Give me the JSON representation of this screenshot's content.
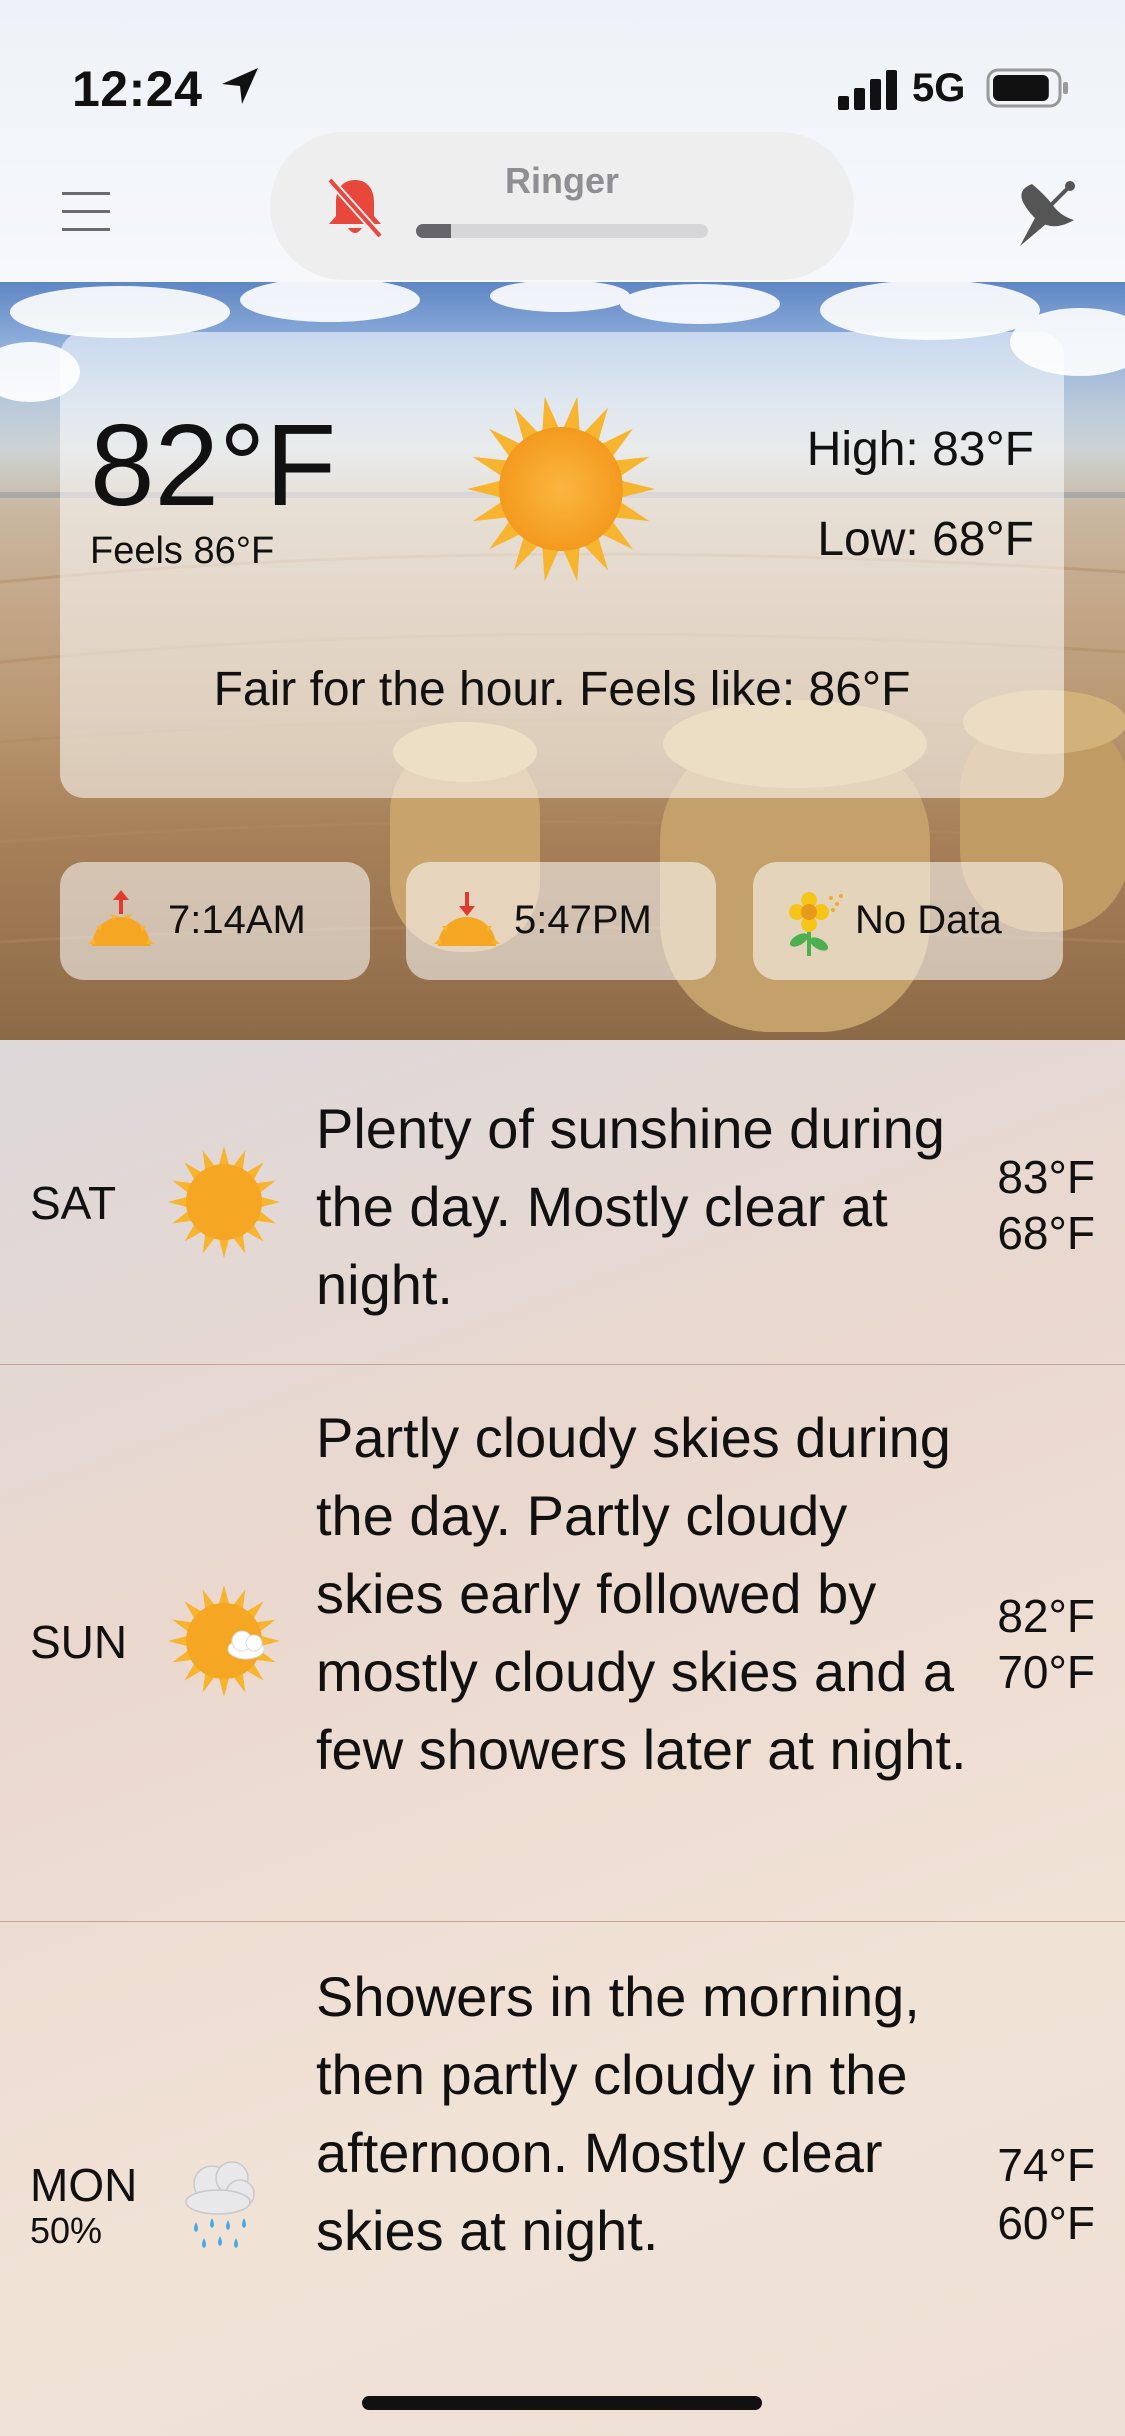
{
  "status_bar": {
    "time": "12:24",
    "network": "5G",
    "signal_bars": 4,
    "battery_level": 0.9
  },
  "header": {
    "ringer": {
      "label": "Ringer",
      "volume": 0.12,
      "muted": true,
      "accent_color": "#e8473c"
    },
    "menu_icon": "hamburger-icon",
    "right_icon": "satellite-dish-icon"
  },
  "current": {
    "temperature": "82°F",
    "feels_like": "Feels 86°F",
    "condition_icon": "sun-icon",
    "high": "High: 83°F",
    "low": "Low: 68°F",
    "summary": "Fair for the hour. Feels like: 86°F"
  },
  "chips": [
    {
      "icon": "sunrise-icon",
      "label": "7:14AM"
    },
    {
      "icon": "sunset-icon",
      "label": "5:47PM"
    },
    {
      "icon": "pollen-flower-icon",
      "label": "No Data"
    }
  ],
  "forecast": [
    {
      "day": "SAT",
      "precip": "",
      "icon": "sun-icon",
      "description": "Plenty of sunshine during the day. Mostly clear at night.",
      "high": "83°F",
      "low": "68°F"
    },
    {
      "day": "SUN",
      "precip": "",
      "icon": "sun-cloud-icon",
      "description": "Partly cloudy skies during the day. Partly cloudy skies early followed by mostly cloudy skies and a few showers later at night.",
      "high": "82°F",
      "low": "70°F"
    },
    {
      "day": "MON",
      "precip": "50%",
      "icon": "rain-cloud-icon",
      "description": "Showers in the morning, then partly cloudy in the afternoon. Mostly clear skies at night.",
      "high": "74°F",
      "low": "60°F"
    }
  ],
  "colors": {
    "sun": "#f5a623",
    "accent_red": "#e8473c",
    "divider": "#c6a493"
  }
}
